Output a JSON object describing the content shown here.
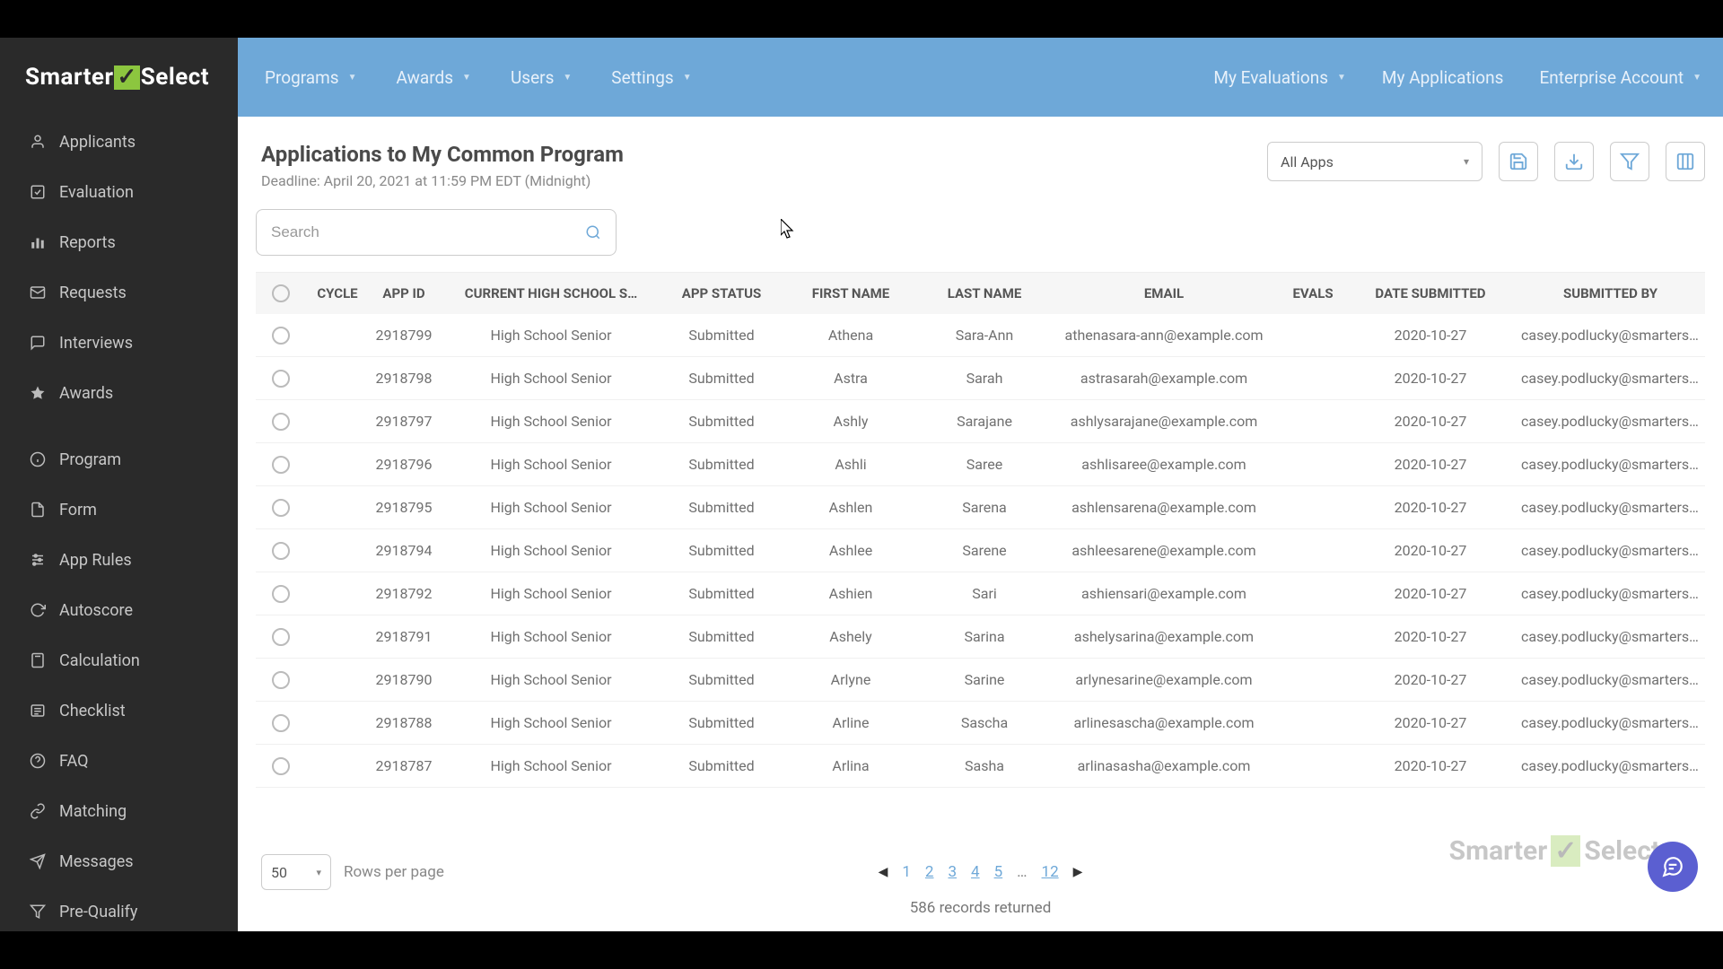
{
  "brand": "SmarterSelect",
  "nav": {
    "left": [
      "Programs",
      "Awards",
      "Users",
      "Settings"
    ],
    "right": [
      "My Evaluations",
      "My Applications",
      "Enterprise Account"
    ]
  },
  "sidebar": [
    {
      "label": "Applicants",
      "icon": "user"
    },
    {
      "label": "Evaluation",
      "icon": "check"
    },
    {
      "label": "Reports",
      "icon": "bars"
    },
    {
      "label": "Requests",
      "icon": "envelope"
    },
    {
      "label": "Interviews",
      "icon": "chat"
    },
    {
      "label": "Awards",
      "icon": "star"
    },
    {
      "label": "Program",
      "icon": "info",
      "sep": true
    },
    {
      "label": "Form",
      "icon": "doc"
    },
    {
      "label": "App Rules",
      "icon": "sliders"
    },
    {
      "label": "Autoscore",
      "icon": "refresh"
    },
    {
      "label": "Calculation",
      "icon": "calc"
    },
    {
      "label": "Checklist",
      "icon": "list"
    },
    {
      "label": "FAQ",
      "icon": "help"
    },
    {
      "label": "Matching",
      "icon": "link"
    },
    {
      "label": "Messages",
      "icon": "send"
    },
    {
      "label": "Pre-Qualify",
      "icon": "funnel"
    }
  ],
  "page": {
    "title": "Applications to My Common Program",
    "deadline": "Deadline: April 20, 2021 at 11:59 PM EDT (Midnight)",
    "filter_select": "All Apps",
    "search_placeholder": "Search"
  },
  "columns": [
    "CYCLE",
    "APP ID",
    "CURRENT HIGH SCHOOL S…",
    "APP STATUS",
    "FIRST NAME",
    "LAST NAME",
    "EMAIL",
    "EVALS",
    "DATE SUBMITTED",
    "SUBMITTED BY"
  ],
  "rows": [
    {
      "id": "2918799",
      "school": "High School Senior",
      "status": "Submitted",
      "first": "Athena",
      "last": "Sara-Ann",
      "email": "athenasara-ann@example.com",
      "date": "2020-10-27",
      "by": "casey.podlucky@smarterselect.c"
    },
    {
      "id": "2918798",
      "school": "High School Senior",
      "status": "Submitted",
      "first": "Astra",
      "last": "Sarah",
      "email": "astrasarah@example.com",
      "date": "2020-10-27",
      "by": "casey.podlucky@smarterselect.c"
    },
    {
      "id": "2918797",
      "school": "High School Senior",
      "status": "Submitted",
      "first": "Ashly",
      "last": "Sarajane",
      "email": "ashlysarajane@example.com",
      "date": "2020-10-27",
      "by": "casey.podlucky@smarterselect.c"
    },
    {
      "id": "2918796",
      "school": "High School Senior",
      "status": "Submitted",
      "first": "Ashli",
      "last": "Saree",
      "email": "ashlisaree@example.com",
      "date": "2020-10-27",
      "by": "casey.podlucky@smarterselect.c"
    },
    {
      "id": "2918795",
      "school": "High School Senior",
      "status": "Submitted",
      "first": "Ashlen",
      "last": "Sarena",
      "email": "ashlensarena@example.com",
      "date": "2020-10-27",
      "by": "casey.podlucky@smarterselect.c"
    },
    {
      "id": "2918794",
      "school": "High School Senior",
      "status": "Submitted",
      "first": "Ashlee",
      "last": "Sarene",
      "email": "ashleesarene@example.com",
      "date": "2020-10-27",
      "by": "casey.podlucky@smarterselect.c"
    },
    {
      "id": "2918792",
      "school": "High School Senior",
      "status": "Submitted",
      "first": "Ashien",
      "last": "Sari",
      "email": "ashiensari@example.com",
      "date": "2020-10-27",
      "by": "casey.podlucky@smarterselect.c"
    },
    {
      "id": "2918791",
      "school": "High School Senior",
      "status": "Submitted",
      "first": "Ashely",
      "last": "Sarina",
      "email": "ashelysarina@example.com",
      "date": "2020-10-27",
      "by": "casey.podlucky@smarterselect.c"
    },
    {
      "id": "2918790",
      "school": "High School Senior",
      "status": "Submitted",
      "first": "Arlyne",
      "last": "Sarine",
      "email": "arlynesarine@example.com",
      "date": "2020-10-27",
      "by": "casey.podlucky@smarterselect.c"
    },
    {
      "id": "2918788",
      "school": "High School Senior",
      "status": "Submitted",
      "first": "Arline",
      "last": "Sascha",
      "email": "arlinesascha@example.com",
      "date": "2020-10-27",
      "by": "casey.podlucky@smarterselect.c"
    },
    {
      "id": "2918787",
      "school": "High School Senior",
      "status": "Submitted",
      "first": "Arlina",
      "last": "Sasha",
      "email": "arlinasasha@example.com",
      "date": "2020-10-27",
      "by": "casey.podlucky@smarterselect.c"
    }
  ],
  "pager": {
    "rows_per_page": "50",
    "rows_label": "Rows per page",
    "pages": [
      "1",
      "2",
      "3",
      "4",
      "5",
      "…",
      "12"
    ],
    "records": "586 records returned"
  }
}
